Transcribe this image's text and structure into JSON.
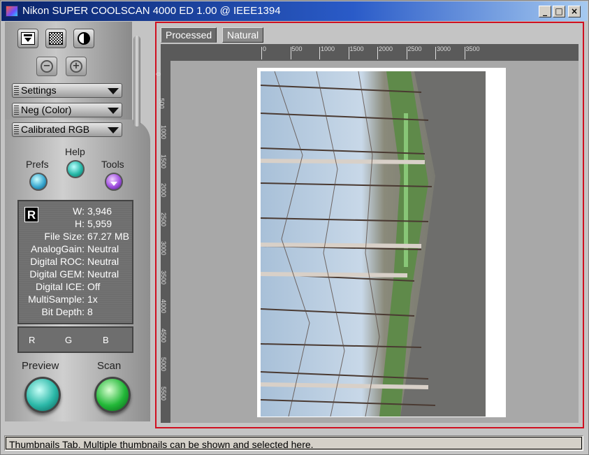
{
  "window": {
    "title": "Nikon SUPER COOLSCAN 4000 ED 1.00 @ IEEE1394",
    "buttons": {
      "minimize": "_",
      "maximize": "□",
      "close": "×"
    }
  },
  "toolbar": {
    "icons": [
      "film-eject-icon",
      "grain-filter-icon",
      "exposure-icon"
    ],
    "zoom_out": "−",
    "zoom_in": "+"
  },
  "dropdowns": {
    "settings": "Settings",
    "film_type": "Neg (Color)",
    "color_space": "Calibrated RGB"
  },
  "circle_buttons": {
    "prefs": "Prefs",
    "help": "Help",
    "tools": "Tools"
  },
  "info": {
    "badge": "R",
    "w_label": "W:",
    "w_value": "3,946",
    "h_label": "H:",
    "h_value": "5,959",
    "rows": [
      {
        "key": "File Size:",
        "value": "67.27 MB"
      },
      {
        "key": "AnalogGain:",
        "value": "Neutral"
      },
      {
        "key": "Digital ROC:",
        "value": "Neutral"
      },
      {
        "key": "Digital GEM:",
        "value": "Neutral"
      },
      {
        "key": "Digital ICE:",
        "value": "Off"
      },
      {
        "key": "MultiSample:",
        "value": "1x"
      },
      {
        "key": "Bit Depth:",
        "value": "8"
      }
    ]
  },
  "rgb": {
    "r": "R",
    "g": "G",
    "b": "B"
  },
  "actions": {
    "preview": "Preview",
    "scan": "Scan"
  },
  "tabs": [
    {
      "label": "Processed",
      "active": true
    },
    {
      "label": "Natural",
      "active": false
    }
  ],
  "ruler": {
    "horizontal": [
      "0",
      "500",
      "1000",
      "1500",
      "2000",
      "2500",
      "3000",
      "3500"
    ],
    "vertical": [
      "0",
      "500",
      "1000",
      "1500",
      "2000",
      "2500",
      "3000",
      "3500",
      "4000",
      "4500",
      "5000",
      "5500"
    ]
  },
  "status_bar": {
    "text": "Thumbnails Tab. Multiple thumbnails can be shown and selected here."
  },
  "colors": {
    "title_bar": "#0a246a",
    "selection_border": "#d01020",
    "preview_button": "#2bb8a8",
    "scan_button": "#22b838",
    "prefs_button": "#3aa8d0",
    "help_button": "#28b8a8",
    "tools_button": "#a050e0"
  }
}
